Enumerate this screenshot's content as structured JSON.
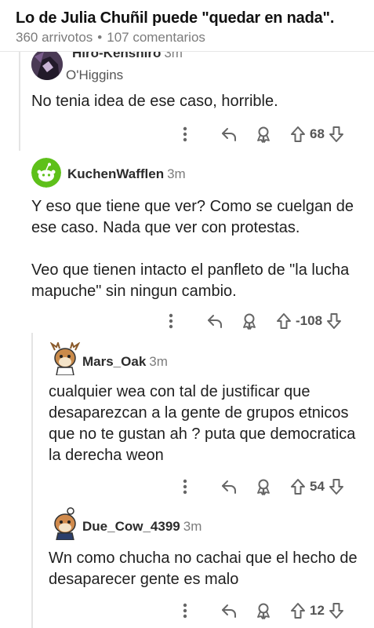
{
  "post": {
    "title": "Lo de Julia Chuñil puede \"quedar en nada\".",
    "upvotes": "360 arrivotos",
    "separator": "•",
    "comments": "107 comentarios"
  },
  "comments": [
    {
      "username": "Hiro-Kenshiro",
      "age": "3m",
      "flair": "O'Higgins",
      "body": [
        "No tenia idea de ese caso, horrible."
      ],
      "score": "68"
    },
    {
      "username": "KuchenWafflen",
      "age": "3m",
      "body": [
        "Y eso que tiene que ver? Como se cuelgan de ese caso. Nada que ver con protestas.",
        "Veo que tienen intacto el panfleto de \"la lucha mapuche\" sin ningun cambio."
      ],
      "score": "-108"
    },
    {
      "username": "Mars_Oak",
      "age": "3m",
      "body": [
        "cualquier wea con tal de justificar que desaparezcan a la gente de grupos etnicos que no te gustan ah ? puta que democratica la derecha weon"
      ],
      "score": "54"
    },
    {
      "username": "Due_Cow_4399",
      "age": "3m",
      "body": [
        "Wn como chucha no cachai que el hecho de desaparecer gente es malo"
      ],
      "score": "12"
    }
  ],
  "colors": {
    "accent_green": "#5ec01a",
    "text_gray": "#7c7c7c",
    "thread_line": "#e4e4e4"
  }
}
